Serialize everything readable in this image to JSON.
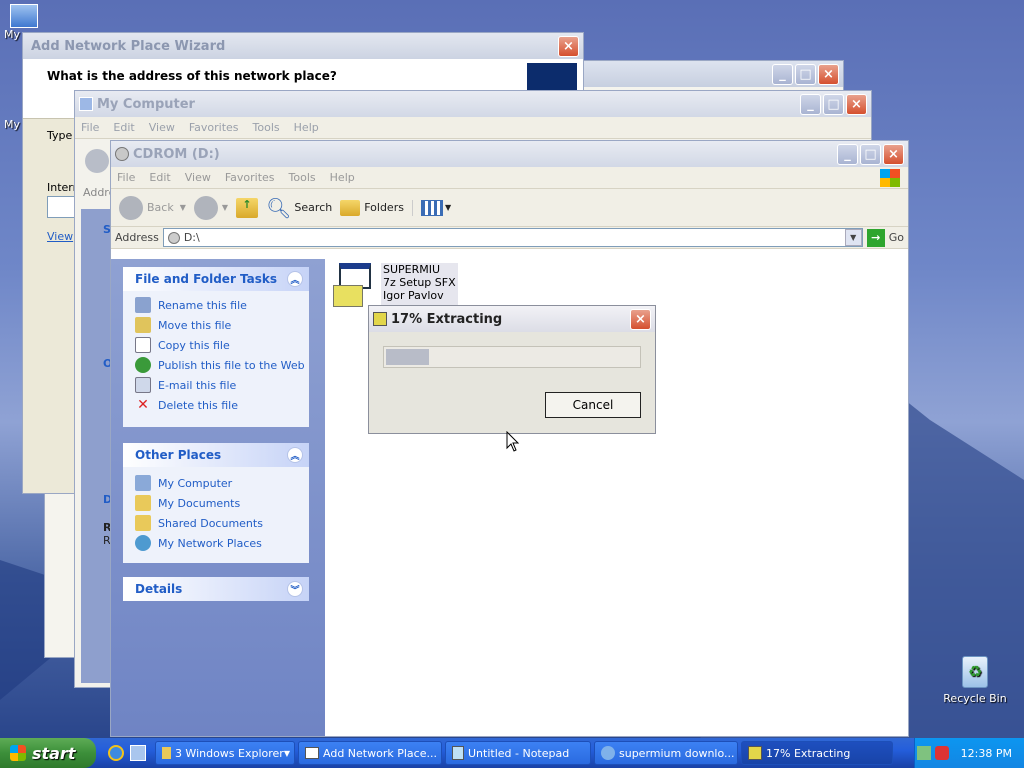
{
  "desktop": {
    "icons": [
      {
        "label": "My"
      },
      {
        "label": "My"
      },
      {
        "label": "Recycle Bin"
      }
    ]
  },
  "wizard": {
    "title": "Add Network Place Wizard",
    "heading": "What is the address of this network place?",
    "type_label": "Type",
    "internet_label": "Intern",
    "view_link": "View"
  },
  "mycomputer": {
    "title": "My Computer",
    "menu": [
      "File",
      "Edit",
      "View",
      "Favorites",
      "Tools",
      "Help"
    ],
    "addr_label": "Addre",
    "pane_letters": [
      "S",
      "O",
      "D",
      "R",
      "R"
    ]
  },
  "cdrom": {
    "title": "CDROM (D:)",
    "menu": [
      "File",
      "Edit",
      "View",
      "Favorites",
      "Tools",
      "Help"
    ],
    "toolbar": {
      "back": "Back",
      "search": "Search",
      "folders": "Folders"
    },
    "address_label": "Address",
    "address_value": "D:\\",
    "go": "Go",
    "file_tasks": {
      "title": "File and Folder Tasks",
      "items": [
        "Rename this file",
        "Move this file",
        "Copy this file",
        "Publish this file to the Web",
        "E-mail this file",
        "Delete this file"
      ]
    },
    "other_places": {
      "title": "Other Places",
      "items": [
        "My Computer",
        "My Documents",
        "Shared Documents",
        "My Network Places"
      ]
    },
    "details": {
      "title": "Details"
    },
    "file": {
      "name": "SUPERMIU",
      "type": "7z Setup SFX",
      "company": "Igor Pavlov"
    }
  },
  "extract": {
    "title": "17% Extracting",
    "progress": 0.17,
    "cancel": "Cancel"
  },
  "taskbar": {
    "start": "start",
    "tasks": [
      {
        "label": "3 Windows Explorer"
      },
      {
        "label": "Add Network Place..."
      },
      {
        "label": "Untitled - Notepad"
      },
      {
        "label": "supermium downlo..."
      },
      {
        "label": "17% Extracting"
      }
    ],
    "clock": "12:38 PM"
  },
  "colors": {
    "xp_blue": "#245edb",
    "link": "#215dc6",
    "start_green": "#3c8f3a"
  }
}
